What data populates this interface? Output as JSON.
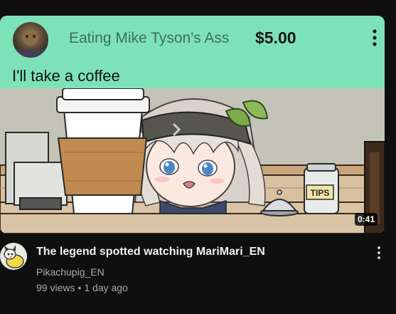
{
  "superchat": {
    "author": "Eating Mike Tyson's Ass",
    "amount": "$5.00",
    "message": "I'll take a coffee",
    "background_color": "#7ee2b8",
    "author_color": "#3e6f5b"
  },
  "thumbnail": {
    "duration": "0:41",
    "cup_text": "",
    "jar_label": "TIPS"
  },
  "video": {
    "title": "The legend spotted watching MariMari_EN",
    "channel": "Pikachupig_EN",
    "views": "99 views",
    "separator": "•",
    "age": "1 day ago"
  },
  "icons": {
    "superchat_menu": "vertical-dots-icon",
    "video_menu": "vertical-dots-icon"
  }
}
